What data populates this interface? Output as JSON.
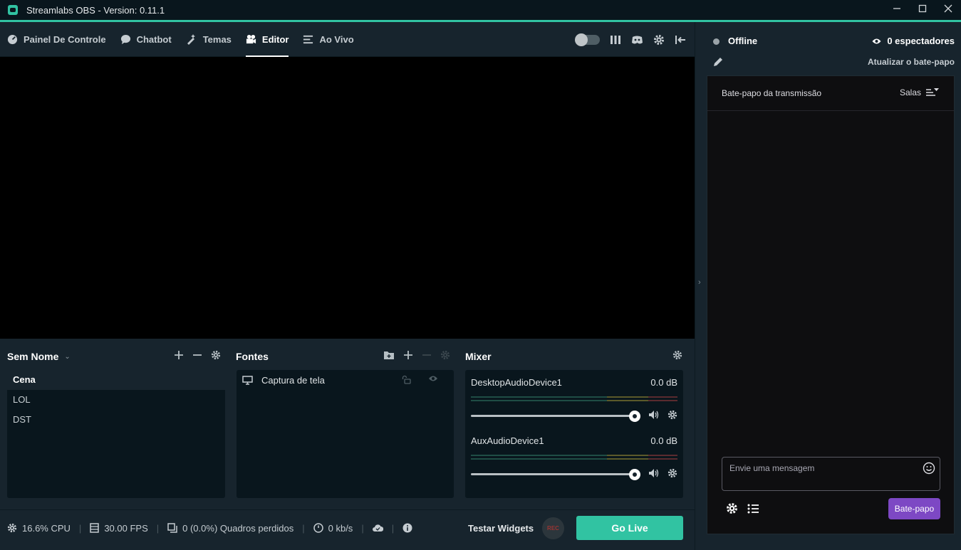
{
  "window": {
    "title": "Streamlabs OBS - Version: 0.11.1",
    "controls": [
      "minimize-icon",
      "maximize-icon",
      "close-icon"
    ]
  },
  "nav": {
    "items": [
      {
        "label": "Painel De Controle",
        "icon": "dashboard-icon"
      },
      {
        "label": "Chatbot",
        "icon": "chatbot-icon"
      },
      {
        "label": "Temas",
        "icon": "themes-icon"
      },
      {
        "label": "Editor",
        "icon": "editor-icon",
        "active": true
      },
      {
        "label": "Ao Vivo",
        "icon": "live-icon"
      }
    ],
    "right_icons": [
      "night-mode-toggle",
      "studio-mode-icon",
      "discord-icon",
      "settings-icon",
      "collapse-icon"
    ]
  },
  "scenes": {
    "collection_name": "Sem Nome",
    "items": [
      "Cena",
      "LOL",
      "DST"
    ],
    "selected": "Cena"
  },
  "sources": {
    "title": "Fontes",
    "items": [
      {
        "label": "Captura de tela",
        "icon": "monitor-icon"
      }
    ]
  },
  "mixer": {
    "title": "Mixer",
    "devices": [
      {
        "name": "DesktopAudioDevice1",
        "db": "0.0 dB",
        "volume": 1.0
      },
      {
        "name": "AuxAudioDevice1",
        "db": "0.0 dB",
        "volume": 1.0
      }
    ]
  },
  "footer": {
    "cpu": "16.6% CPU",
    "fps": "30.00 FPS",
    "dropped": "0 (0.0%) Quadros perdidos",
    "bitrate": "0 kb/s",
    "test_widgets": "Testar Widgets",
    "rec": "REC",
    "go_live": "Go Live"
  },
  "chat": {
    "status": "Offline",
    "viewers": "0 espectadores",
    "refresh": "Atualizar o bate-papo",
    "header_title": "Bate-papo da transmissão",
    "rooms": "Salas",
    "input_placeholder": "Envie uma mensagem",
    "send_button": "Bate-papo"
  },
  "colors": {
    "accent": "#31c3a2",
    "panel": "#17242d",
    "background": "#09161d",
    "chat_button": "#7d48c4"
  }
}
